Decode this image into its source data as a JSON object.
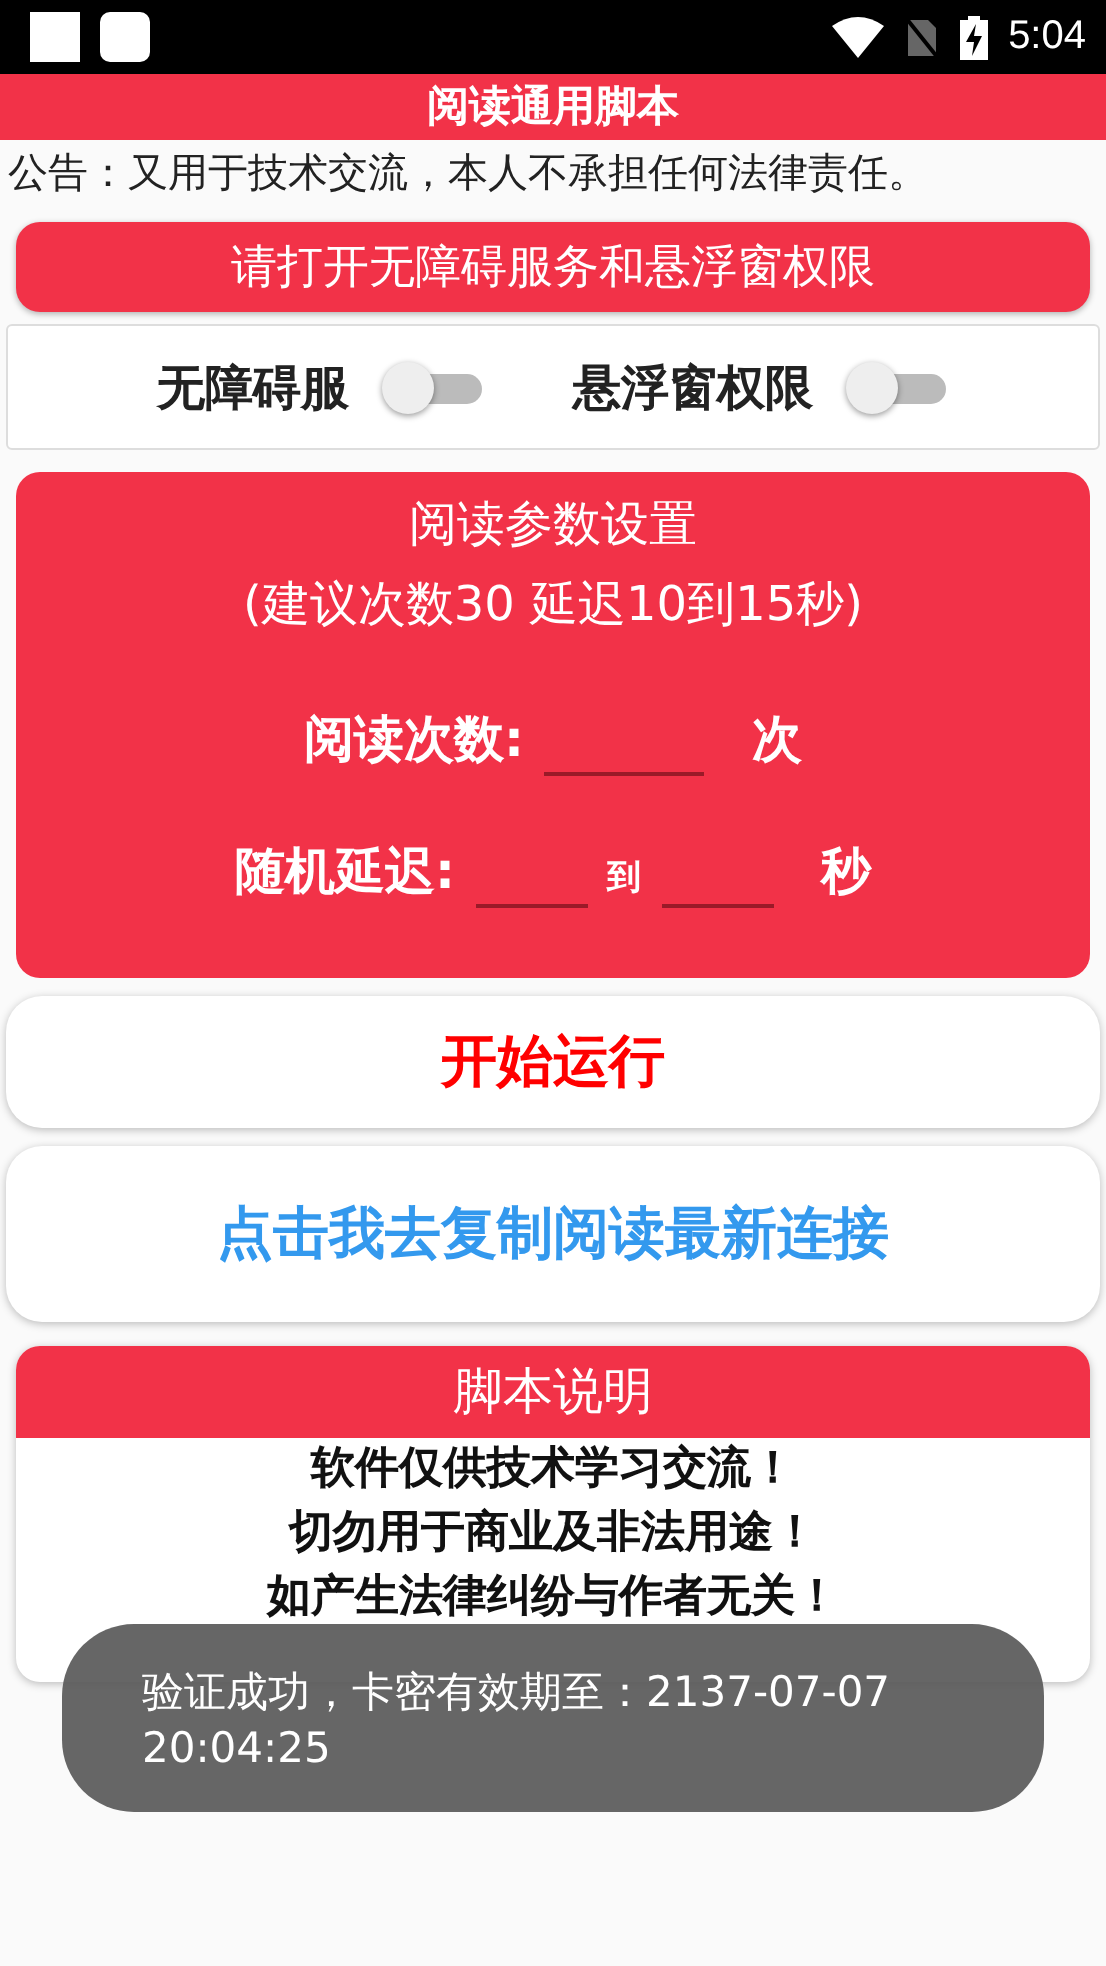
{
  "status_bar": {
    "time": "5:04"
  },
  "title": "阅读通用脚本",
  "notice": "公告：又用于技术交流，本人不承担任何法律责任。",
  "permission_button": "请打开无障碍服务和悬浮窗权限",
  "switches": [
    {
      "label": "无障碍服",
      "on": false
    },
    {
      "label": "悬浮窗权限",
      "on": false
    }
  ],
  "settings": {
    "title": "阅读参数设置",
    "hint": "(建议次数30  延迟10到15秒)",
    "count_label": "阅读次数:",
    "count_unit": "次",
    "delay_label": "随机延迟:",
    "delay_to": "到",
    "delay_unit": "秒"
  },
  "start_button": "开始运行",
  "copy_link_button": "点击我去复制阅读最新连接",
  "description": {
    "title": "脚本说明",
    "lines": [
      "软件仅供技术学习交流！",
      "切勿用于商业及非法用途！",
      "如产生法律纠纷与作者无关！"
    ]
  },
  "toast": "验证成功，卡密有效期至：2137-07-07 20:04:25"
}
